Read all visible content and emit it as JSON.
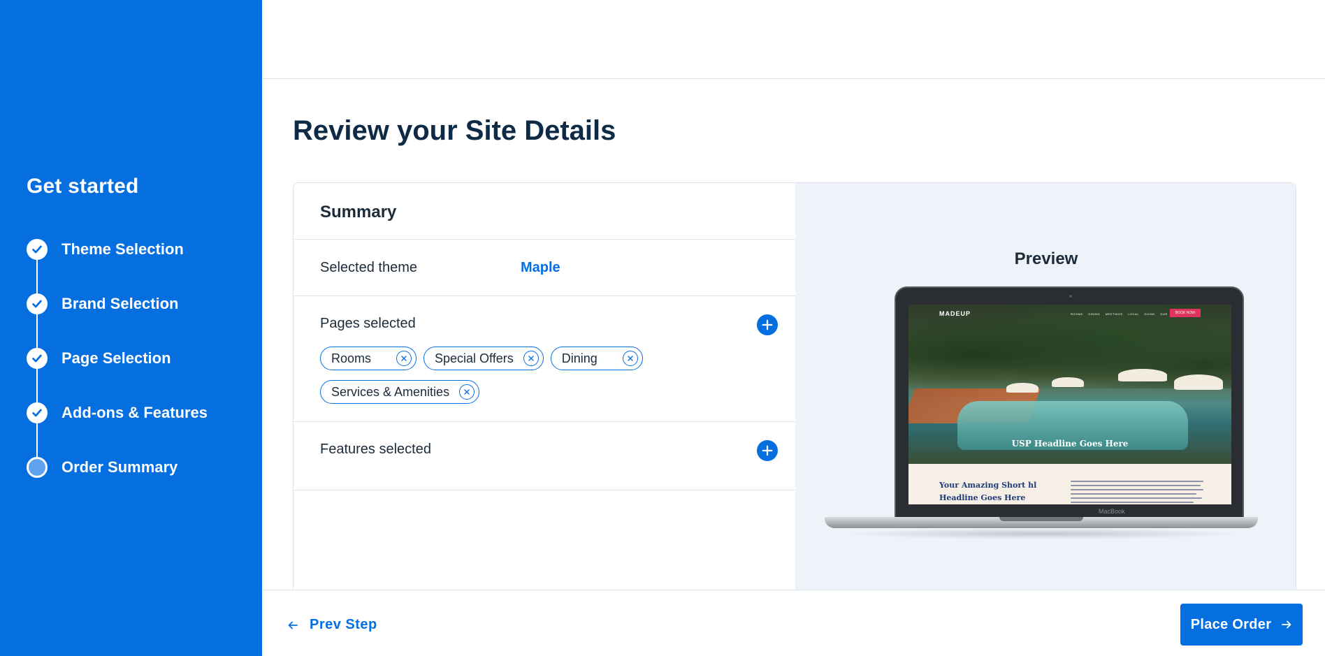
{
  "sidebar": {
    "title": "Get started",
    "steps": [
      {
        "label": "Theme Selection",
        "status": "done"
      },
      {
        "label": "Brand Selection",
        "status": "done"
      },
      {
        "label": "Page Selection",
        "status": "done"
      },
      {
        "label": "Add-ons & Features",
        "status": "done"
      },
      {
        "label": "Order Summary",
        "status": "current"
      }
    ]
  },
  "main": {
    "title": "Review your Site Details",
    "summary": {
      "heading": "Summary",
      "selected_theme_label": "Selected theme",
      "selected_theme_value": "Maple",
      "pages_label": "Pages selected",
      "pages": [
        "Rooms",
        "Special Offers",
        "Dining",
        "Services & Amenities"
      ],
      "features_label": "Features selected"
    },
    "preview": {
      "title": "Preview",
      "screen": {
        "logo": "MADEUP",
        "menu": "ROOMS DINING MEETINGS LOCAL GUIDE OUR HOTEL",
        "book_button": "BOOK NOW",
        "hero_headline": "USP Headline Goes Here",
        "content_headline": "Your Amazing Short hl Headline Goes Here",
        "laptop_label": "MacBook"
      }
    }
  },
  "footer": {
    "prev_label": "Prev Step",
    "next_label": "Place Order"
  },
  "colors": {
    "primary": "#066fe0",
    "sidebar_bg": "#066fe0",
    "preview_bg": "#eef3fa",
    "heading_text": "#0f2a44"
  }
}
